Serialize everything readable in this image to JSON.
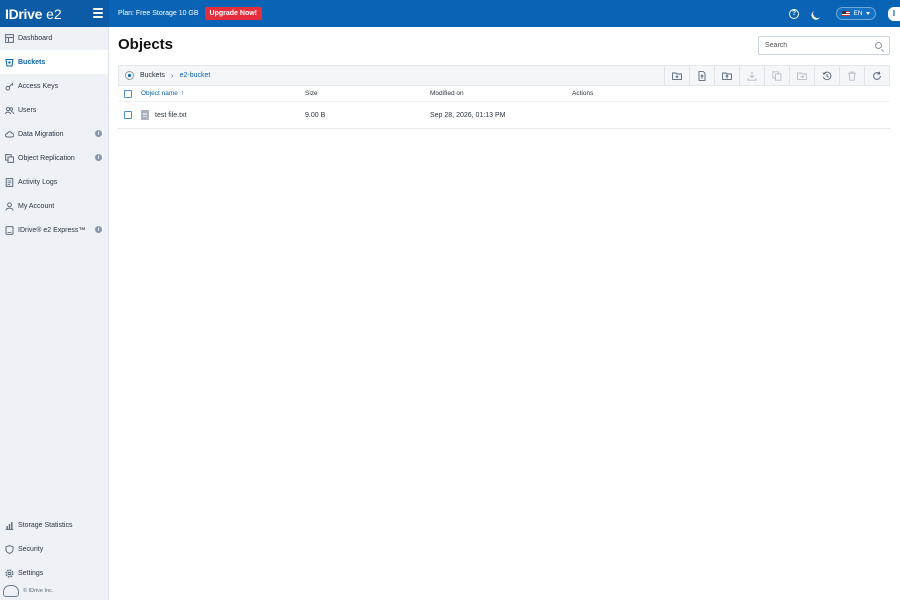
{
  "header": {
    "logo": "IDrive",
    "logo_suffix": "e2",
    "plan": "Plan: Free Storage 10 GB",
    "upgrade_label": "Upgrade Now!",
    "lang": "EN",
    "avatar": "I"
  },
  "sidebar": {
    "items": [
      {
        "label": "Dashboard"
      },
      {
        "label": "Buckets"
      },
      {
        "label": "Access Keys"
      },
      {
        "label": "Users"
      },
      {
        "label": "Data Migration"
      },
      {
        "label": "Object Replication"
      },
      {
        "label": "Activity Logs"
      },
      {
        "label": "My Account"
      },
      {
        "label": "IDrive® e2 Express™"
      }
    ],
    "bottom_items": [
      {
        "label": "Storage Statistics"
      },
      {
        "label": "Security"
      },
      {
        "label": "Settings"
      }
    ],
    "footer": "© IDrive Inc."
  },
  "main": {
    "title": "Objects",
    "search_placeholder": "Search",
    "breadcrumb": [
      "Buckets",
      "e2-bucket"
    ],
    "columns": {
      "name": "Object name",
      "size": "Size",
      "modified": "Modified on",
      "actions": "Actions"
    },
    "rows": [
      {
        "name": "test file.txt",
        "size": "9.00 B",
        "modified": "Sep 28, 2026, 01:13 PM"
      }
    ]
  },
  "colors": {
    "brand": "#0b63b5",
    "upgrade": "#e52d3b"
  }
}
